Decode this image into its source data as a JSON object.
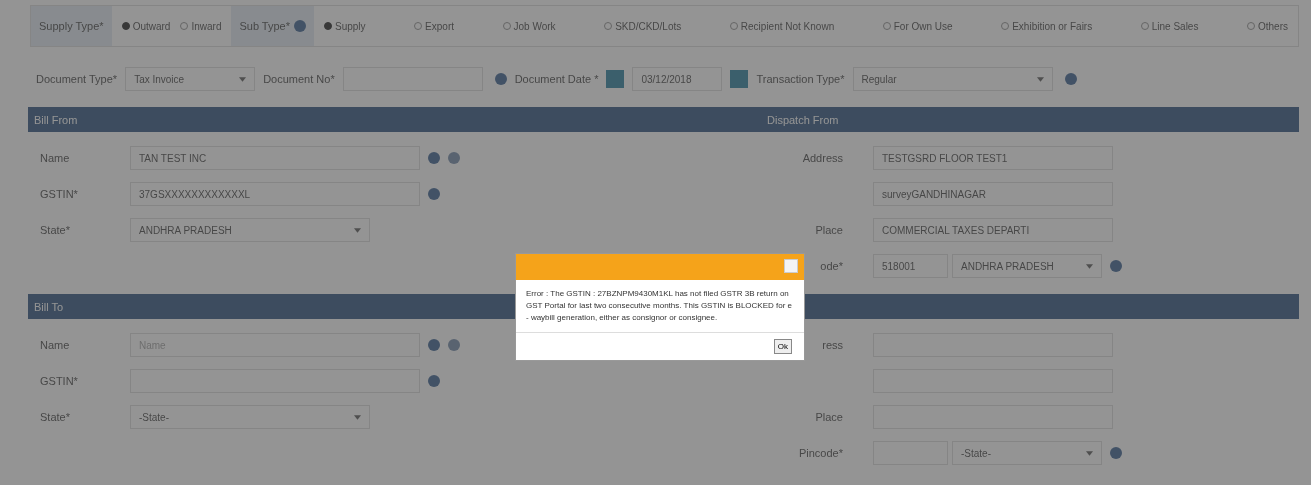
{
  "supply_type": {
    "label": "Supply Type*",
    "options": [
      {
        "label": "Outward",
        "selected": true
      },
      {
        "label": "Inward",
        "selected": false
      }
    ]
  },
  "sub_type": {
    "label": "Sub Type*",
    "options": [
      {
        "label": "Supply",
        "selected": true
      },
      {
        "label": "Export",
        "selected": false
      },
      {
        "label": "Job Work",
        "selected": false
      },
      {
        "label": "SKD/CKD/Lots",
        "selected": false
      },
      {
        "label": "Recipient Not Known",
        "selected": false
      },
      {
        "label": "For Own Use",
        "selected": false
      },
      {
        "label": "Exhibition or Fairs",
        "selected": false
      },
      {
        "label": "Line Sales",
        "selected": false
      },
      {
        "label": "Others",
        "selected": false
      }
    ]
  },
  "document": {
    "type_label": "Document Type*",
    "type_value": "Tax Invoice",
    "no_label": "Document No*",
    "date_label": "Document Date *",
    "date_value": "03/12/2018",
    "transaction_label": "Transaction Type*",
    "transaction_value": "Regular"
  },
  "sections": [
    {
      "left_title": "Bill From",
      "right_title": "Dispatch From",
      "left_rows": [
        {
          "kind": "text",
          "label": "Name",
          "value": "TAN TEST INC",
          "help": true,
          "info": true
        },
        {
          "kind": "text",
          "label": "GSTIN*",
          "value": "37GSXXXXXXXXXXXXL",
          "help": true
        },
        {
          "kind": "select",
          "label": "State*",
          "value": "ANDHRA PRADESH"
        }
      ],
      "right_rows": [
        {
          "kind": "text",
          "label": "Address",
          "value": "TESTGSRD FLOOR TEST1"
        },
        {
          "kind": "text",
          "label": "",
          "value": "surveyGANDHINAGAR"
        },
        {
          "kind": "text",
          "label": "Place",
          "value": "COMMERCIAL TAXES DEPARTI"
        },
        {
          "kind": "pin",
          "label": "ode*",
          "value": "518001",
          "state": "ANDHRA PRADESH"
        }
      ]
    },
    {
      "left_title": "Bill To",
      "left_rows": [
        {
          "kind": "text",
          "label": "Name",
          "placeholder": "Name",
          "help": true,
          "info": true
        },
        {
          "kind": "text",
          "label": "GSTIN*",
          "help": true
        },
        {
          "kind": "select",
          "label": "State*",
          "value": "-State-"
        }
      ],
      "right_rows": [
        {
          "kind": "text",
          "label": "ress"
        },
        {
          "kind": "text",
          "label": ""
        },
        {
          "kind": "text",
          "label": "Place"
        },
        {
          "kind": "pin",
          "label": "Pincode*",
          "state": "-State-"
        }
      ]
    }
  ],
  "dialog": {
    "message": "Error : The GSTIN : 27BZNPM9430M1KL has not filed GSTR 3B return on GST Portal for last two consecutive months. This GSTIN is BLOCKED for e - waybill generation, either as consignor or consignee.",
    "button": "Ok"
  }
}
